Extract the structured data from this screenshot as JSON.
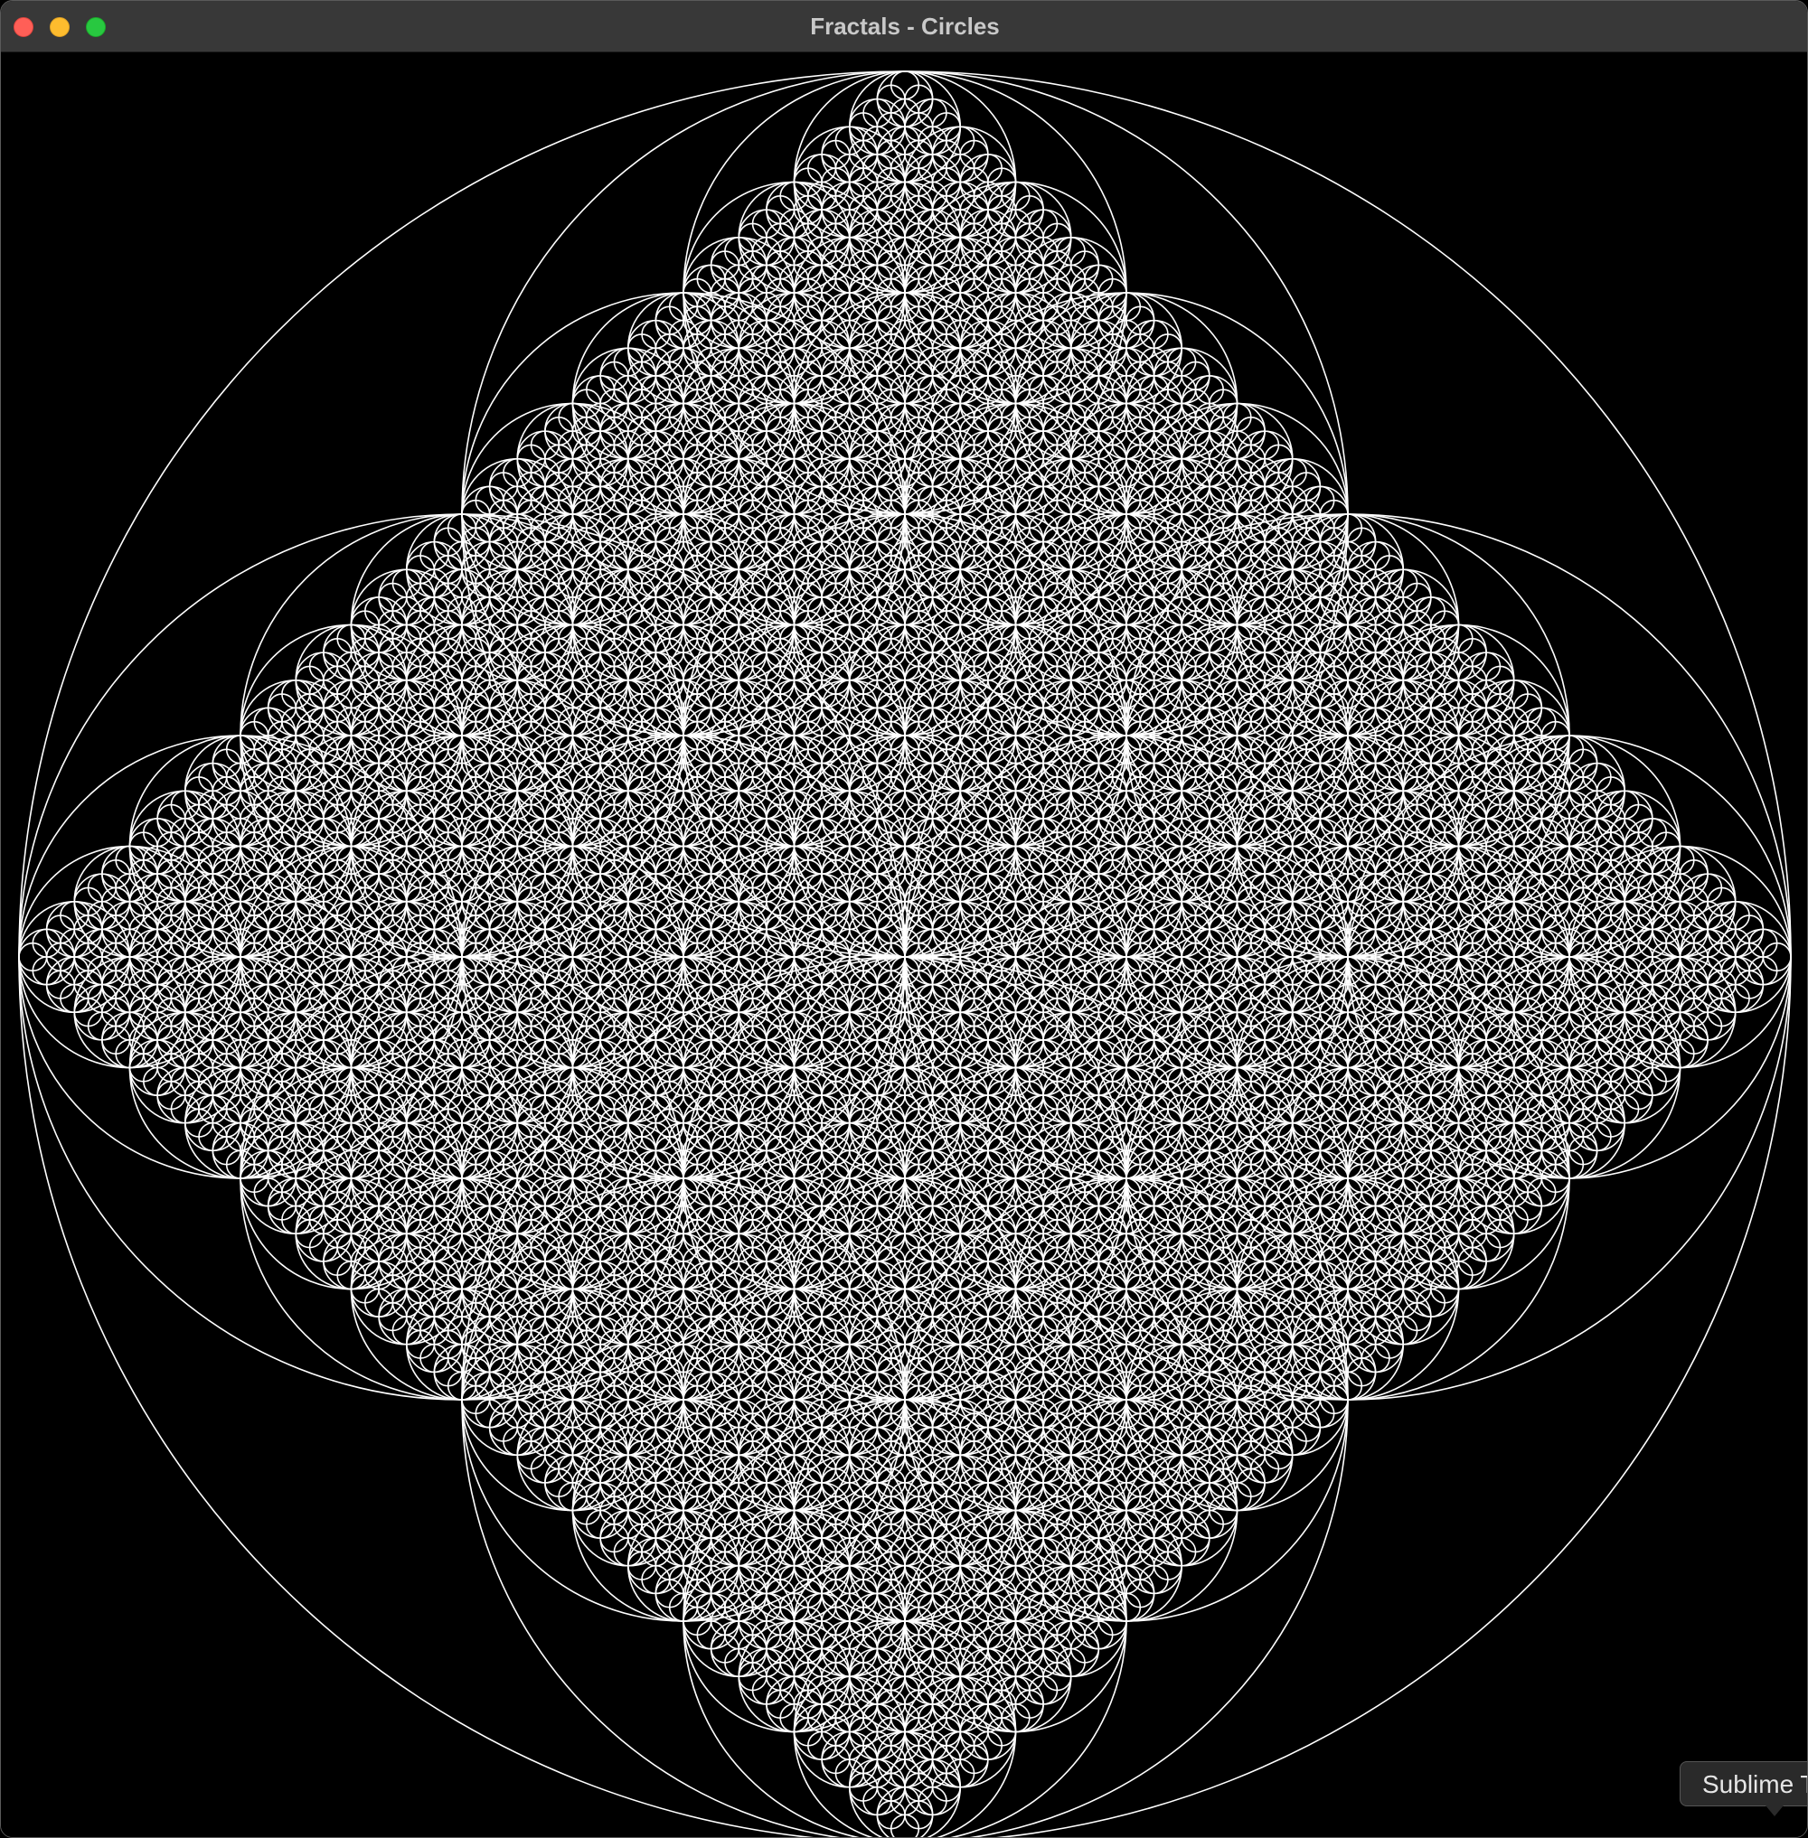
{
  "window": {
    "title": "Fractals - Circles",
    "controls": {
      "close": "close-icon",
      "minimize": "minimize-icon",
      "zoom": "zoom-icon"
    }
  },
  "canvas": {
    "background": "#000000",
    "stroke": "#ffffff",
    "content": "fractal-circles"
  },
  "tooltip": {
    "text": "Sublime T"
  }
}
